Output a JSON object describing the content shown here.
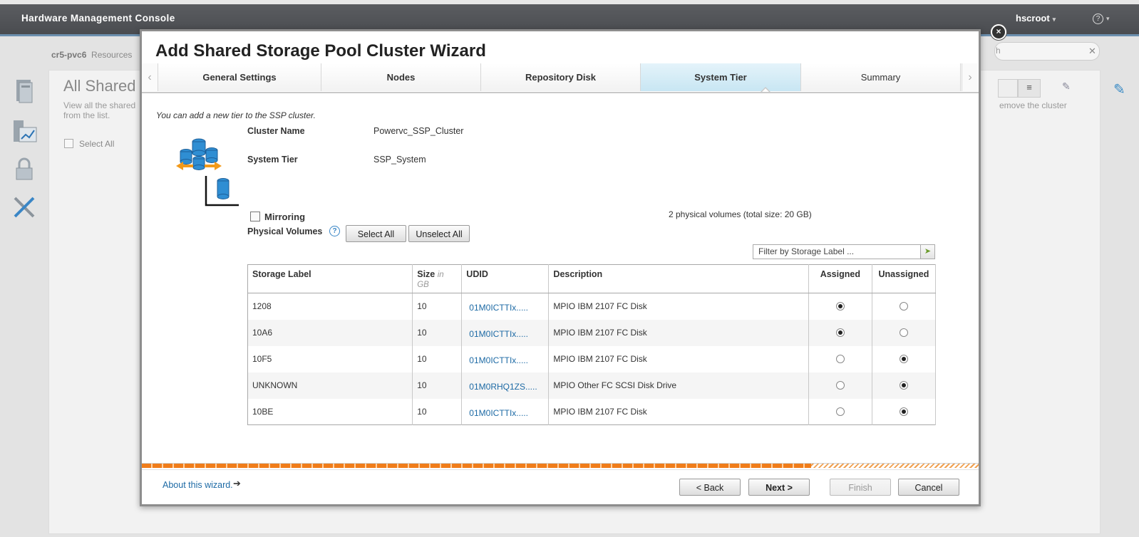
{
  "header": {
    "app_title": "Hardware Management Console",
    "user": "hscroot",
    "help_icon": "?"
  },
  "background": {
    "breadcrumb_system": "cr5-pvc6",
    "breadcrumb_resources": "Resources",
    "heading": "All Shared",
    "description": "View all the shared from the list.",
    "select_all": "Select All",
    "right_description": "emove the cluster",
    "search_placeholder": "h"
  },
  "wizard": {
    "title": "Add Shared Storage Pool Cluster Wizard",
    "close_label": "×",
    "tabs": [
      {
        "label": "General Settings"
      },
      {
        "label": "Nodes"
      },
      {
        "label": "Repository Disk"
      },
      {
        "label": "System Tier",
        "active": true
      },
      {
        "label": "Summary"
      }
    ],
    "intro": "You can add a new tier to the SSP cluster.",
    "cluster_name_label": "Cluster Name",
    "cluster_name_value": "Powervc_SSP_Cluster",
    "system_tier_label": "System Tier",
    "system_tier_value": "SSP_System",
    "mirroring_label": "Mirroring",
    "mirroring_checked": false,
    "physical_volumes_label": "Physical Volumes",
    "pv_summary": "2 physical volumes (total size: 20 GB)",
    "select_all_button": "Select All",
    "unselect_all_button": "Unselect All",
    "filter_placeholder": "Filter by Storage Label ...",
    "table": {
      "headers": {
        "storage_label": "Storage Label",
        "size": "Size",
        "size_unit_in": "in",
        "size_unit_gb": "GB",
        "udid": "UDID",
        "description": "Description",
        "assigned": "Assigned",
        "unassigned": "Unassigned"
      },
      "rows": [
        {
          "label": "1208",
          "size": "10",
          "udid": "01M0ICTTIx.....",
          "description": "MPIO IBM 2107 FC Disk",
          "assigned": true
        },
        {
          "label": "10A6",
          "size": "10",
          "udid": "01M0ICTTIx.....",
          "description": "MPIO IBM 2107 FC Disk",
          "assigned": true
        },
        {
          "label": "10F5",
          "size": "10",
          "udid": "01M0ICTTIx.....",
          "description": "MPIO IBM 2107 FC Disk",
          "assigned": false
        },
        {
          "label": "UNKNOWN",
          "size": "10",
          "udid": "01M0RHQ1ZS.....",
          "description": "MPIO Other FC SCSI Disk Drive",
          "assigned": false
        },
        {
          "label": "10BE",
          "size": "10",
          "udid": "01M0ICTTIx.....",
          "description": "MPIO IBM 2107 FC Disk",
          "assigned": false
        }
      ]
    },
    "progress_fraction": 0.8,
    "about_link": "About this wizard.",
    "back_button": "< Back",
    "next_button": "Next >",
    "finish_button": "Finish",
    "cancel_button": "Cancel",
    "accent_color": "#f07d1a",
    "active_tab_color": "#c8e6f3"
  }
}
